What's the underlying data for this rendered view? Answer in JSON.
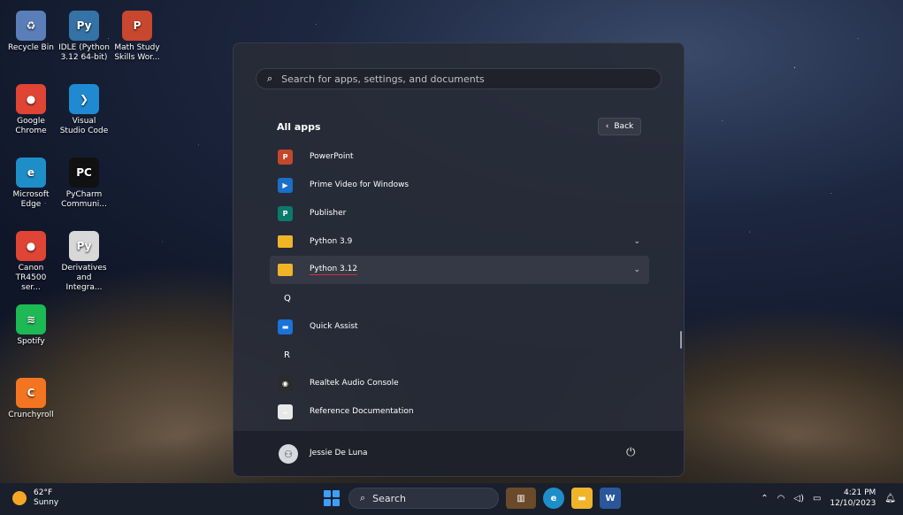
{
  "desktop": {
    "icons": [
      {
        "label": "Recycle Bin",
        "icon": "recycle-bin-icon",
        "glyph": "♻",
        "color": "#5a7fb8"
      },
      {
        "label": "IDLE (Python 3.12 64-bit)",
        "icon": "python-idle-icon",
        "glyph": "Py",
        "color": "#3572a5"
      },
      {
        "label": "Math Study Skills Wor...",
        "icon": "document-icon",
        "glyph": "P",
        "color": "#c9472e"
      },
      {
        "label": "Google Chrome",
        "icon": "chrome-icon",
        "glyph": "●",
        "color": "#e04434"
      },
      {
        "label": "Visual Studio Code",
        "icon": "vscode-icon",
        "glyph": "❯",
        "color": "#1f8ad2"
      },
      {
        "label": "Microsoft Edge",
        "icon": "edge-icon",
        "glyph": "e",
        "color": "#1e8ec9"
      },
      {
        "label": "PyCharm Communi...",
        "icon": "pycharm-icon",
        "glyph": "PC",
        "color": "#111111"
      },
      {
        "label": "Canon TR4500 ser...",
        "icon": "chrome-icon",
        "glyph": "●",
        "color": "#e04434"
      },
      {
        "label": "Derivatives and Integra...",
        "icon": "python-file-icon",
        "glyph": "Py",
        "color": "#d8d8d8"
      },
      {
        "label": "Spotify",
        "icon": "spotify-icon",
        "glyph": "≋",
        "color": "#1db954"
      },
      {
        "label": "Crunchyroll",
        "icon": "crunchyroll-icon",
        "glyph": "C",
        "color": "#f47521"
      }
    ]
  },
  "start_menu": {
    "search_placeholder": "Search for apps, settings, and documents",
    "section_title": "All apps",
    "back_label": "Back",
    "apps": [
      {
        "label": "PowerPoint",
        "type": "app",
        "icon": "powerpoint-icon",
        "glyph": "P",
        "color": "#c4472b"
      },
      {
        "label": "Prime Video for Windows",
        "type": "app",
        "icon": "prime-video-icon",
        "glyph": "▶",
        "color": "#1a6fc9"
      },
      {
        "label": "Publisher",
        "type": "app",
        "icon": "publisher-icon",
        "glyph": "P",
        "color": "#0b7a6a"
      },
      {
        "label": "Python 3.9",
        "type": "folder",
        "icon": "folder-icon",
        "glyph": "",
        "color": "#f0b429"
      },
      {
        "label": "Python 3.12",
        "type": "folder",
        "icon": "folder-icon",
        "glyph": "",
        "color": "#f0b429"
      },
      {
        "label": "Q",
        "type": "letter"
      },
      {
        "label": "Quick Assist",
        "type": "app",
        "icon": "quick-assist-icon",
        "glyph": "▬",
        "color": "#1a73d9"
      },
      {
        "label": "R",
        "type": "letter"
      },
      {
        "label": "Realtek Audio Console",
        "type": "app",
        "icon": "realtek-icon",
        "glyph": "◉",
        "color": "#2b2b2b"
      },
      {
        "label": "Reference Documentation",
        "type": "app",
        "icon": "java-doc-icon",
        "glyph": "☕",
        "color": "#e8e8e8"
      }
    ],
    "user_name": "Jessie De Luna"
  },
  "taskbar": {
    "temperature": "62°F",
    "condition": "Sunny",
    "search_label": "Search",
    "time": "4:21 PM",
    "date": "12/10/2023"
  }
}
